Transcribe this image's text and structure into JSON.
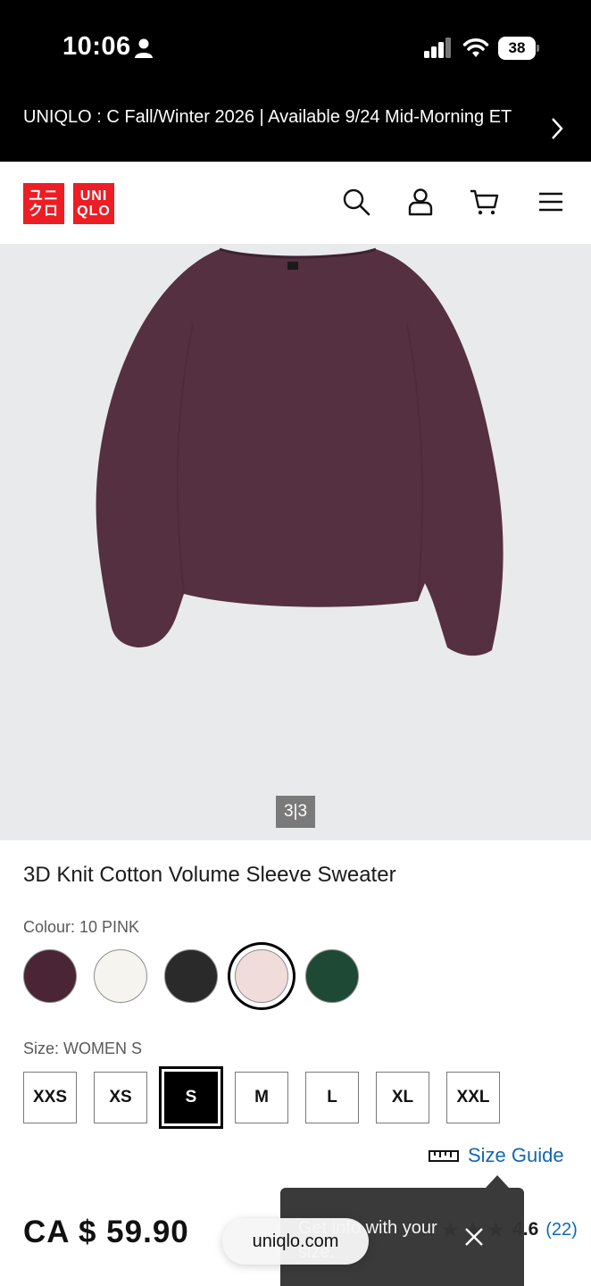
{
  "status_bar": {
    "time": "10:06",
    "battery": "38"
  },
  "announcement": {
    "text": "UNIQLO : C Fall/Winter 2026 | Available 9/24 Mid-Morning ET"
  },
  "header": {
    "logo_top": [
      "ユニ",
      "クロ"
    ],
    "logo_right": [
      "UNI",
      "QLO"
    ],
    "icons": [
      "search-icon",
      "account-icon",
      "cart-icon",
      "menu-icon"
    ]
  },
  "gallery": {
    "pager": "3|3"
  },
  "product": {
    "title": "3D Knit Cotton Volume Sleeve Sweater",
    "colour_label": "Colour: 10 PINK",
    "colours": [
      "#4a2535",
      "#f5f4ef",
      "#2a2a2a",
      "#f1dcdc",
      "#1e4a35"
    ],
    "selected_colour_index": 3,
    "size_label": "Size: WOMEN S",
    "sizes": [
      "XXS",
      "XS",
      "S",
      "M",
      "L",
      "XL",
      "XXL"
    ],
    "selected_size": "S",
    "size_guide": "Size Guide",
    "price": "CA $ 59.90",
    "rating_value": "4.6",
    "rating_count": "(22)"
  },
  "toast": {
    "text": "Get info with your size."
  },
  "browser": {
    "url": "uniqlo.com"
  },
  "colors": {
    "brand_red": "#ed1d24",
    "link_blue": "#1267b3"
  }
}
